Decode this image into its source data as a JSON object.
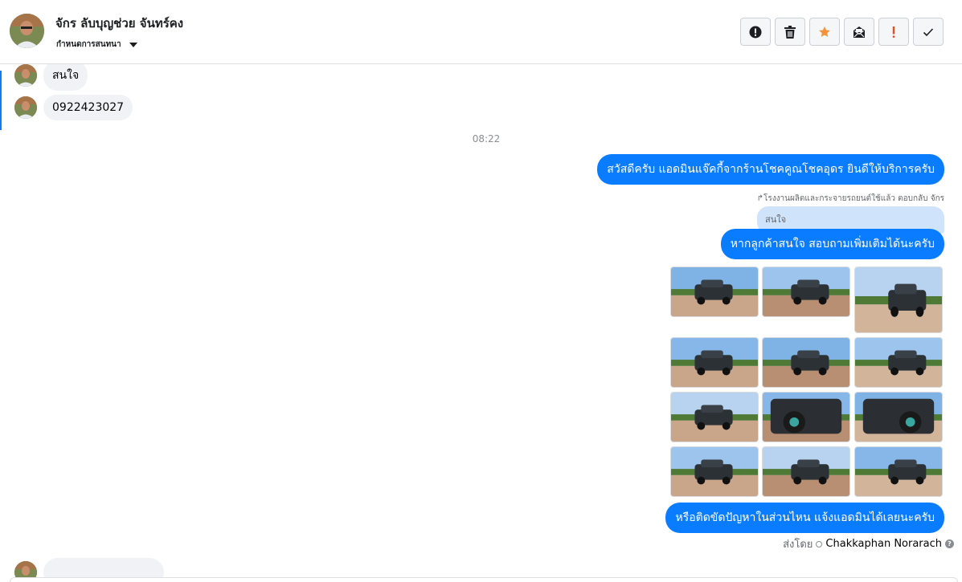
{
  "header": {
    "contact_name": "จักร ลับบุญช่วย จันทร์คง",
    "assign_label": "กำหนดการสนทนา"
  },
  "toolbar": {
    "buttons": [
      {
        "icon": "info-circle-icon"
      },
      {
        "icon": "trash-icon"
      },
      {
        "icon": "star-icon",
        "color": "#f7923a"
      },
      {
        "icon": "mark-unread-icon"
      },
      {
        "icon": "exclamation-icon",
        "color": "#e04e2b"
      },
      {
        "icon": "checkmark-icon"
      }
    ]
  },
  "thread": {
    "incoming": [
      {
        "text": "สนใจ"
      },
      {
        "text": "0922423027"
      }
    ],
    "timestamp": "08:22",
    "outgoing_1": "สวัสดีครับ แอดมินแจ๊คกี้จากร้านโชคคูณโชคอุดร ยินดีให้บริการครับ",
    "reply_meta": "โรงงานผลิตและกระจายรถยนต์ใช้แล้ว ตอบกลับ จักร",
    "quoted_text": "สนใจ",
    "outgoing_2": "หากลูกค้าสนใจ สอบถามเพิ่มเติมได้นะครับ",
    "photo_count": 12,
    "outgoing_3": "หรือติดขัดปัญหาในส่วนไหน แจ้งแอดมินได้เลยนะครับ",
    "sent_by_label": "ส่งโดย",
    "sent_by_name": "Chakkaphan Norarach"
  },
  "colors": {
    "outgoing_bubble": "#0a7cff",
    "incoming_bubble": "#f0f2f5",
    "accent": "#1877f2"
  }
}
